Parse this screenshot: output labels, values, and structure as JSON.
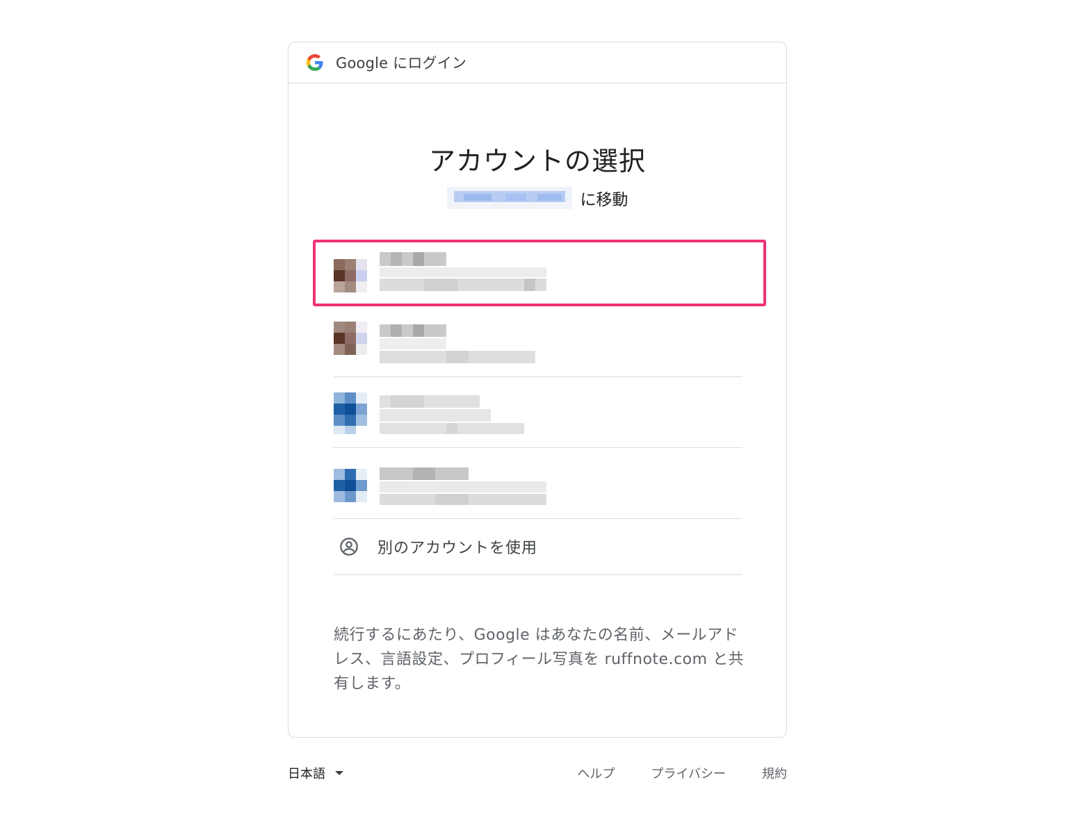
{
  "header": {
    "brand_text": "Google にログイン",
    "logo_icon": "google-g-icon"
  },
  "main": {
    "title": "アカウントの選択",
    "subtitle_suffix": "に移動",
    "use_other_account": "別のアカウントを使用",
    "consent_text": "続行するにあたり、Google はあなたの名前、メールアドレス、言語設定、プロフィール写真を ruffnote.com と共有します。"
  },
  "footer": {
    "language": "日本語",
    "links": [
      "ヘルプ",
      "プライバシー",
      "規約"
    ]
  },
  "colors": {
    "highlight": "#f03277",
    "border": "#dadce0"
  }
}
